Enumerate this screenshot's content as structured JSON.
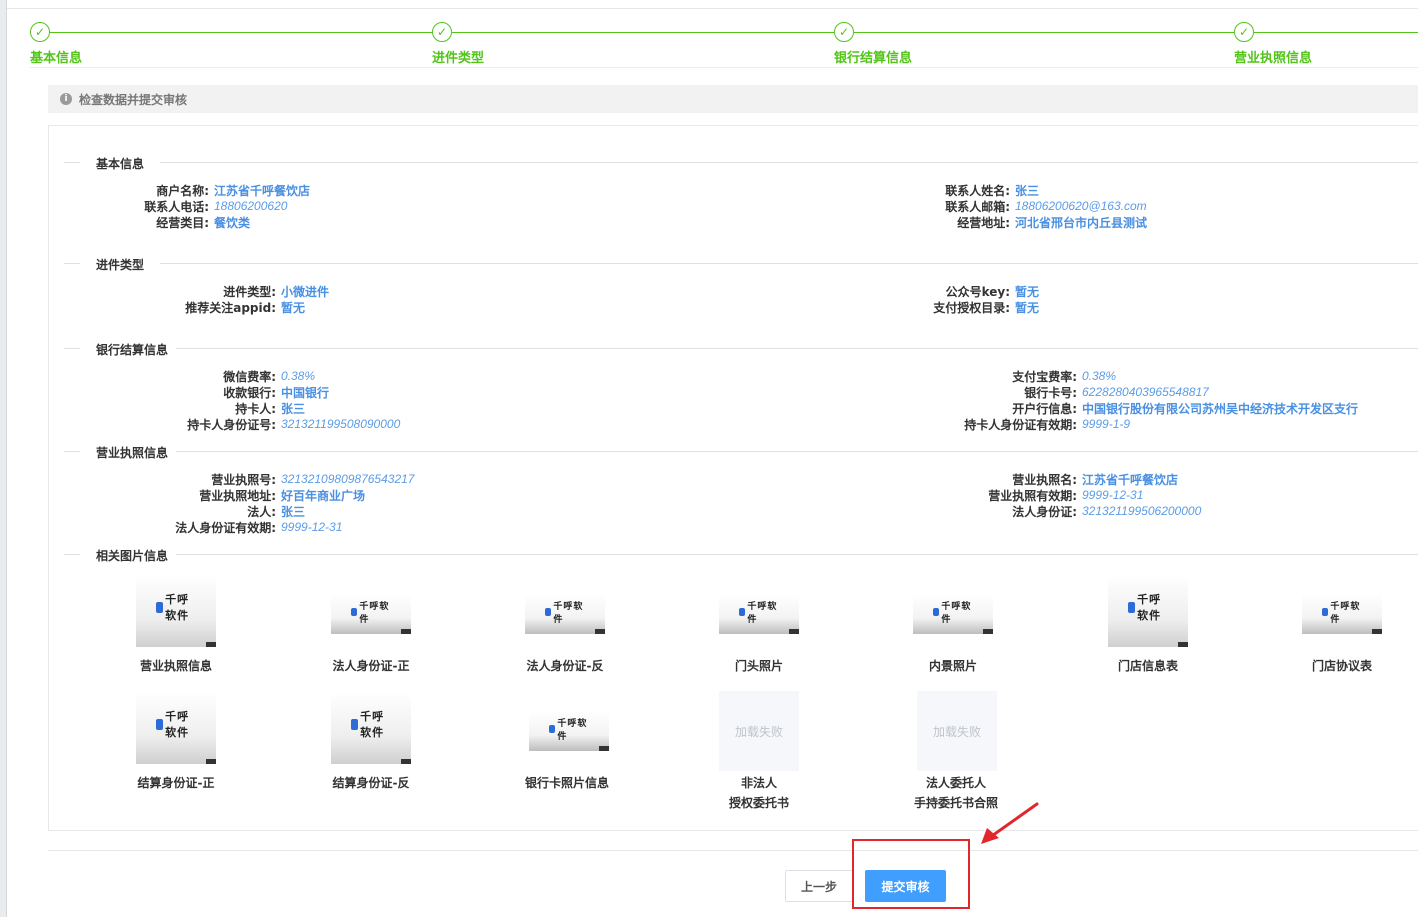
{
  "steps": [
    "基本信息",
    "进件类型",
    "银行结算信息",
    "营业执照信息"
  ],
  "notice": "检查数据并提交审核",
  "sections": {
    "basic": "基本信息",
    "type": "进件类型",
    "bank": "银行结算信息",
    "license": "营业执照信息",
    "images": "相关图片信息"
  },
  "basic": {
    "merchant_name_label": "商户名称:",
    "merchant_name": "江苏省千呼餐饮店",
    "contact_phone_label": "联系人电话:",
    "contact_phone": "18806200620",
    "category_label": "经营类目:",
    "category": "餐饮类",
    "contact_name_label": "联系人姓名:",
    "contact_name": "张三",
    "contact_email_label": "联系人邮箱:",
    "contact_email": "18806200620@163.com",
    "address_label": "经营地址:",
    "address": "河北省邢台市内丘县测试"
  },
  "type": {
    "entry_type_label": "进件类型:",
    "entry_type": "小微进件",
    "recommend_appid_label": "推荐关注appid:",
    "recommend_appid": "暂无",
    "mp_key_label": "公众号key:",
    "mp_key": "暂无",
    "pay_dir_label": "支付授权目录:",
    "pay_dir": "暂无"
  },
  "bank": {
    "wechat_rate_label": "微信费率:",
    "wechat_rate": "0.38%",
    "bank_label": "收款银行:",
    "bank": "中国银行",
    "holder_label": "持卡人:",
    "holder": "张三",
    "holder_id_label": "持卡人身份证号:",
    "holder_id": "321321199508090000",
    "alipay_rate_label": "支付宝费率:",
    "alipay_rate": "0.38%",
    "card_no_label": "银行卡号:",
    "card_no": "6228280403965548817",
    "branch_label": "开户行信息:",
    "branch": "中国银行股份有限公司苏州吴中经济技术开发区支行",
    "holder_id_exp_label": "持卡人身份证有效期:",
    "holder_id_exp": "9999-1-9"
  },
  "license": {
    "license_no_label": "营业执照号:",
    "license_no": "32132109809876543217",
    "license_addr_label": "营业执照地址:",
    "license_addr": "好百年商业广场",
    "legal_label": "法人:",
    "legal": "张三",
    "legal_id_exp_label": "法人身份证有效期:",
    "legal_id_exp": "9999-12-31",
    "license_name_label": "营业执照名:",
    "license_name": "江苏省千呼餐饮店",
    "license_exp_label": "营业执照有效期:",
    "license_exp": "9999-12-31",
    "legal_id_label": "法人身份证:",
    "legal_id": "321321199506200000"
  },
  "image_brand": "千呼软件",
  "images": [
    {
      "caption": "营业执照信息"
    },
    {
      "caption": "法人身份证-正"
    },
    {
      "caption": "法人身份证-反"
    },
    {
      "caption": "门头照片"
    },
    {
      "caption": "内景照片"
    },
    {
      "caption": "门店信息表"
    },
    {
      "caption": "门店协议表"
    },
    {
      "caption": "结算身份证-正"
    },
    {
      "caption": "结算身份证-反"
    },
    {
      "caption": "银行卡照片信息"
    },
    {
      "caption_line1": "非法人",
      "caption_line2": "授权委托书",
      "failed_text": "加载失败"
    },
    {
      "caption_line1": "法人委托人",
      "caption_line2": "手持委托书合照",
      "failed_text": "加载失败"
    }
  ],
  "buttons": {
    "prev": "上一步",
    "submit": "提交审核"
  },
  "colors": {
    "success": "#52c41a",
    "link": "#4a90e2",
    "primary": "#409eff",
    "annotation": "#e3262e"
  }
}
